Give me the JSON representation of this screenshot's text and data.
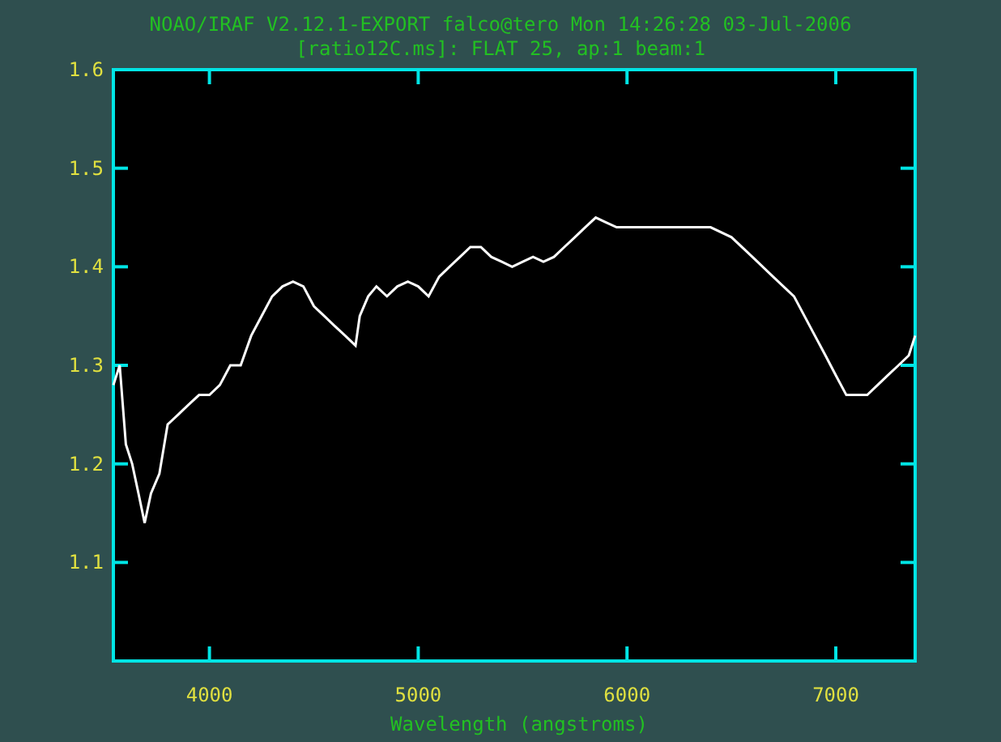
{
  "header": {
    "title": "NOAO/IRAF V2.12.1-EXPORT falco@tero Mon 14:26:28 03-Jul-2006",
    "subtitle": "[ratio12C.ms]: FLAT 25, ap:1 beam:1"
  },
  "chart_data": {
    "type": "line",
    "xlabel": "Wavelength (angstroms)",
    "xlim": [
      3540,
      7380
    ],
    "ylim": [
      1.0,
      1.6
    ],
    "xticks": [
      4000,
      5000,
      6000,
      7000
    ],
    "yticks": [
      1.1,
      1.2,
      1.3,
      1.4,
      1.5,
      1.6
    ],
    "x": [
      3540,
      3570,
      3600,
      3630,
      3660,
      3690,
      3720,
      3760,
      3800,
      3850,
      3900,
      3950,
      4000,
      4050,
      4100,
      4150,
      4200,
      4250,
      4300,
      4350,
      4400,
      4450,
      4500,
      4550,
      4600,
      4650,
      4700,
      4720,
      4760,
      4800,
      4850,
      4900,
      4950,
      5000,
      5050,
      5100,
      5150,
      5200,
      5250,
      5300,
      5350,
      5400,
      5450,
      5500,
      5550,
      5600,
      5650,
      5700,
      5750,
      5800,
      5850,
      5900,
      5950,
      6000,
      6100,
      6200,
      6300,
      6400,
      6500,
      6600,
      6700,
      6800,
      6900,
      6950,
      7000,
      7050,
      7100,
      7150,
      7200,
      7250,
      7300,
      7350,
      7380
    ],
    "series": [
      {
        "color": "#ffffff",
        "values": [
          1.28,
          1.3,
          1.22,
          1.2,
          1.17,
          1.14,
          1.17,
          1.19,
          1.24,
          1.25,
          1.26,
          1.27,
          1.27,
          1.28,
          1.3,
          1.3,
          1.33,
          1.35,
          1.37,
          1.38,
          1.385,
          1.38,
          1.36,
          1.35,
          1.34,
          1.33,
          1.32,
          1.35,
          1.37,
          1.38,
          1.37,
          1.38,
          1.385,
          1.38,
          1.37,
          1.39,
          1.4,
          1.41,
          1.42,
          1.42,
          1.41,
          1.405,
          1.4,
          1.405,
          1.41,
          1.405,
          1.41,
          1.42,
          1.43,
          1.44,
          1.45,
          1.445,
          1.44,
          1.44,
          1.44,
          1.44,
          1.44,
          1.44,
          1.43,
          1.41,
          1.39,
          1.37,
          1.33,
          1.31,
          1.29,
          1.27,
          1.27,
          1.27,
          1.28,
          1.29,
          1.3,
          1.31,
          1.33
        ]
      }
    ]
  }
}
